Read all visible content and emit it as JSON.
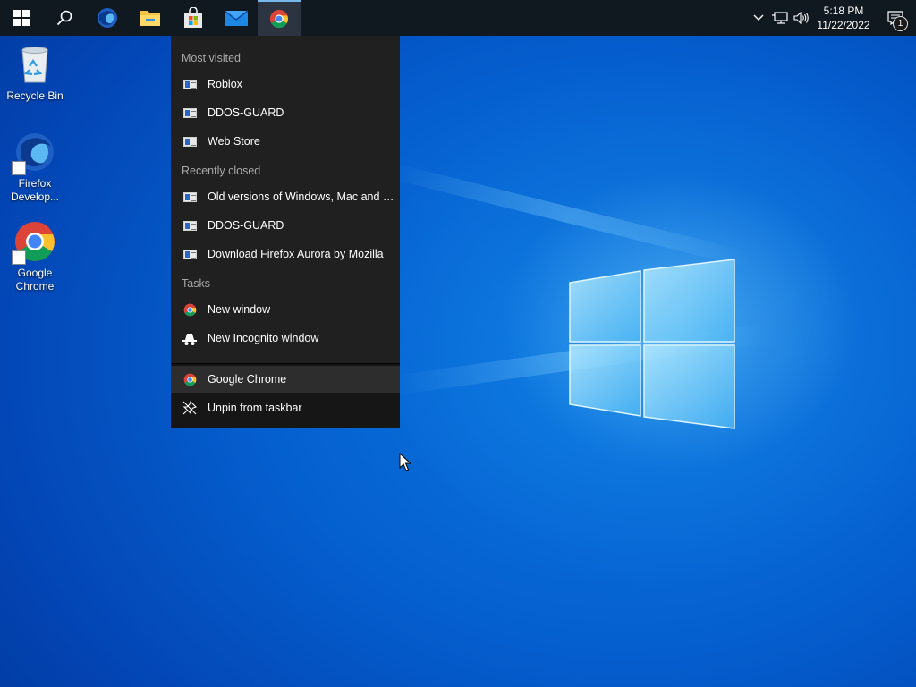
{
  "desktop": {
    "icons": [
      {
        "label": "Recycle Bin",
        "icon": "recycle-bin-icon"
      },
      {
        "label": "Firefox Develop...",
        "icon": "firefox-developer-icon"
      },
      {
        "label": "Google Chrome",
        "icon": "chrome-icon"
      }
    ]
  },
  "taskbar": {
    "buttons": [
      {
        "icon": "windows-start-icon"
      },
      {
        "icon": "search-icon"
      },
      {
        "icon": "firefox-developer-icon"
      },
      {
        "icon": "file-explorer-icon"
      },
      {
        "icon": "microsoft-store-icon"
      },
      {
        "icon": "mail-icon"
      },
      {
        "icon": "chrome-icon",
        "active": true
      }
    ],
    "clock": {
      "time": "5:18 PM",
      "date": "11/22/2022"
    },
    "notification_count": "1"
  },
  "jumplist": {
    "most_visited_header": "Most visited",
    "most_visited": [
      "Roblox",
      "DDOS-GUARD",
      "Web Store"
    ],
    "recently_closed_header": "Recently closed",
    "recently_closed": [
      "Old versions of Windows, Mac and Lin...",
      "DDOS-GUARD",
      "Download Firefox Aurora by Mozilla"
    ],
    "tasks_header": "Tasks",
    "tasks": [
      {
        "label": "New window",
        "icon": "chrome-icon"
      },
      {
        "label": "New Incognito window",
        "icon": "incognito-icon"
      }
    ],
    "app_item": "Google Chrome",
    "unpin_item": "Unpin from taskbar"
  },
  "colors": {
    "accent": "#76b9ed",
    "taskbar": "#101820",
    "jumplist_bg": "#202020"
  }
}
